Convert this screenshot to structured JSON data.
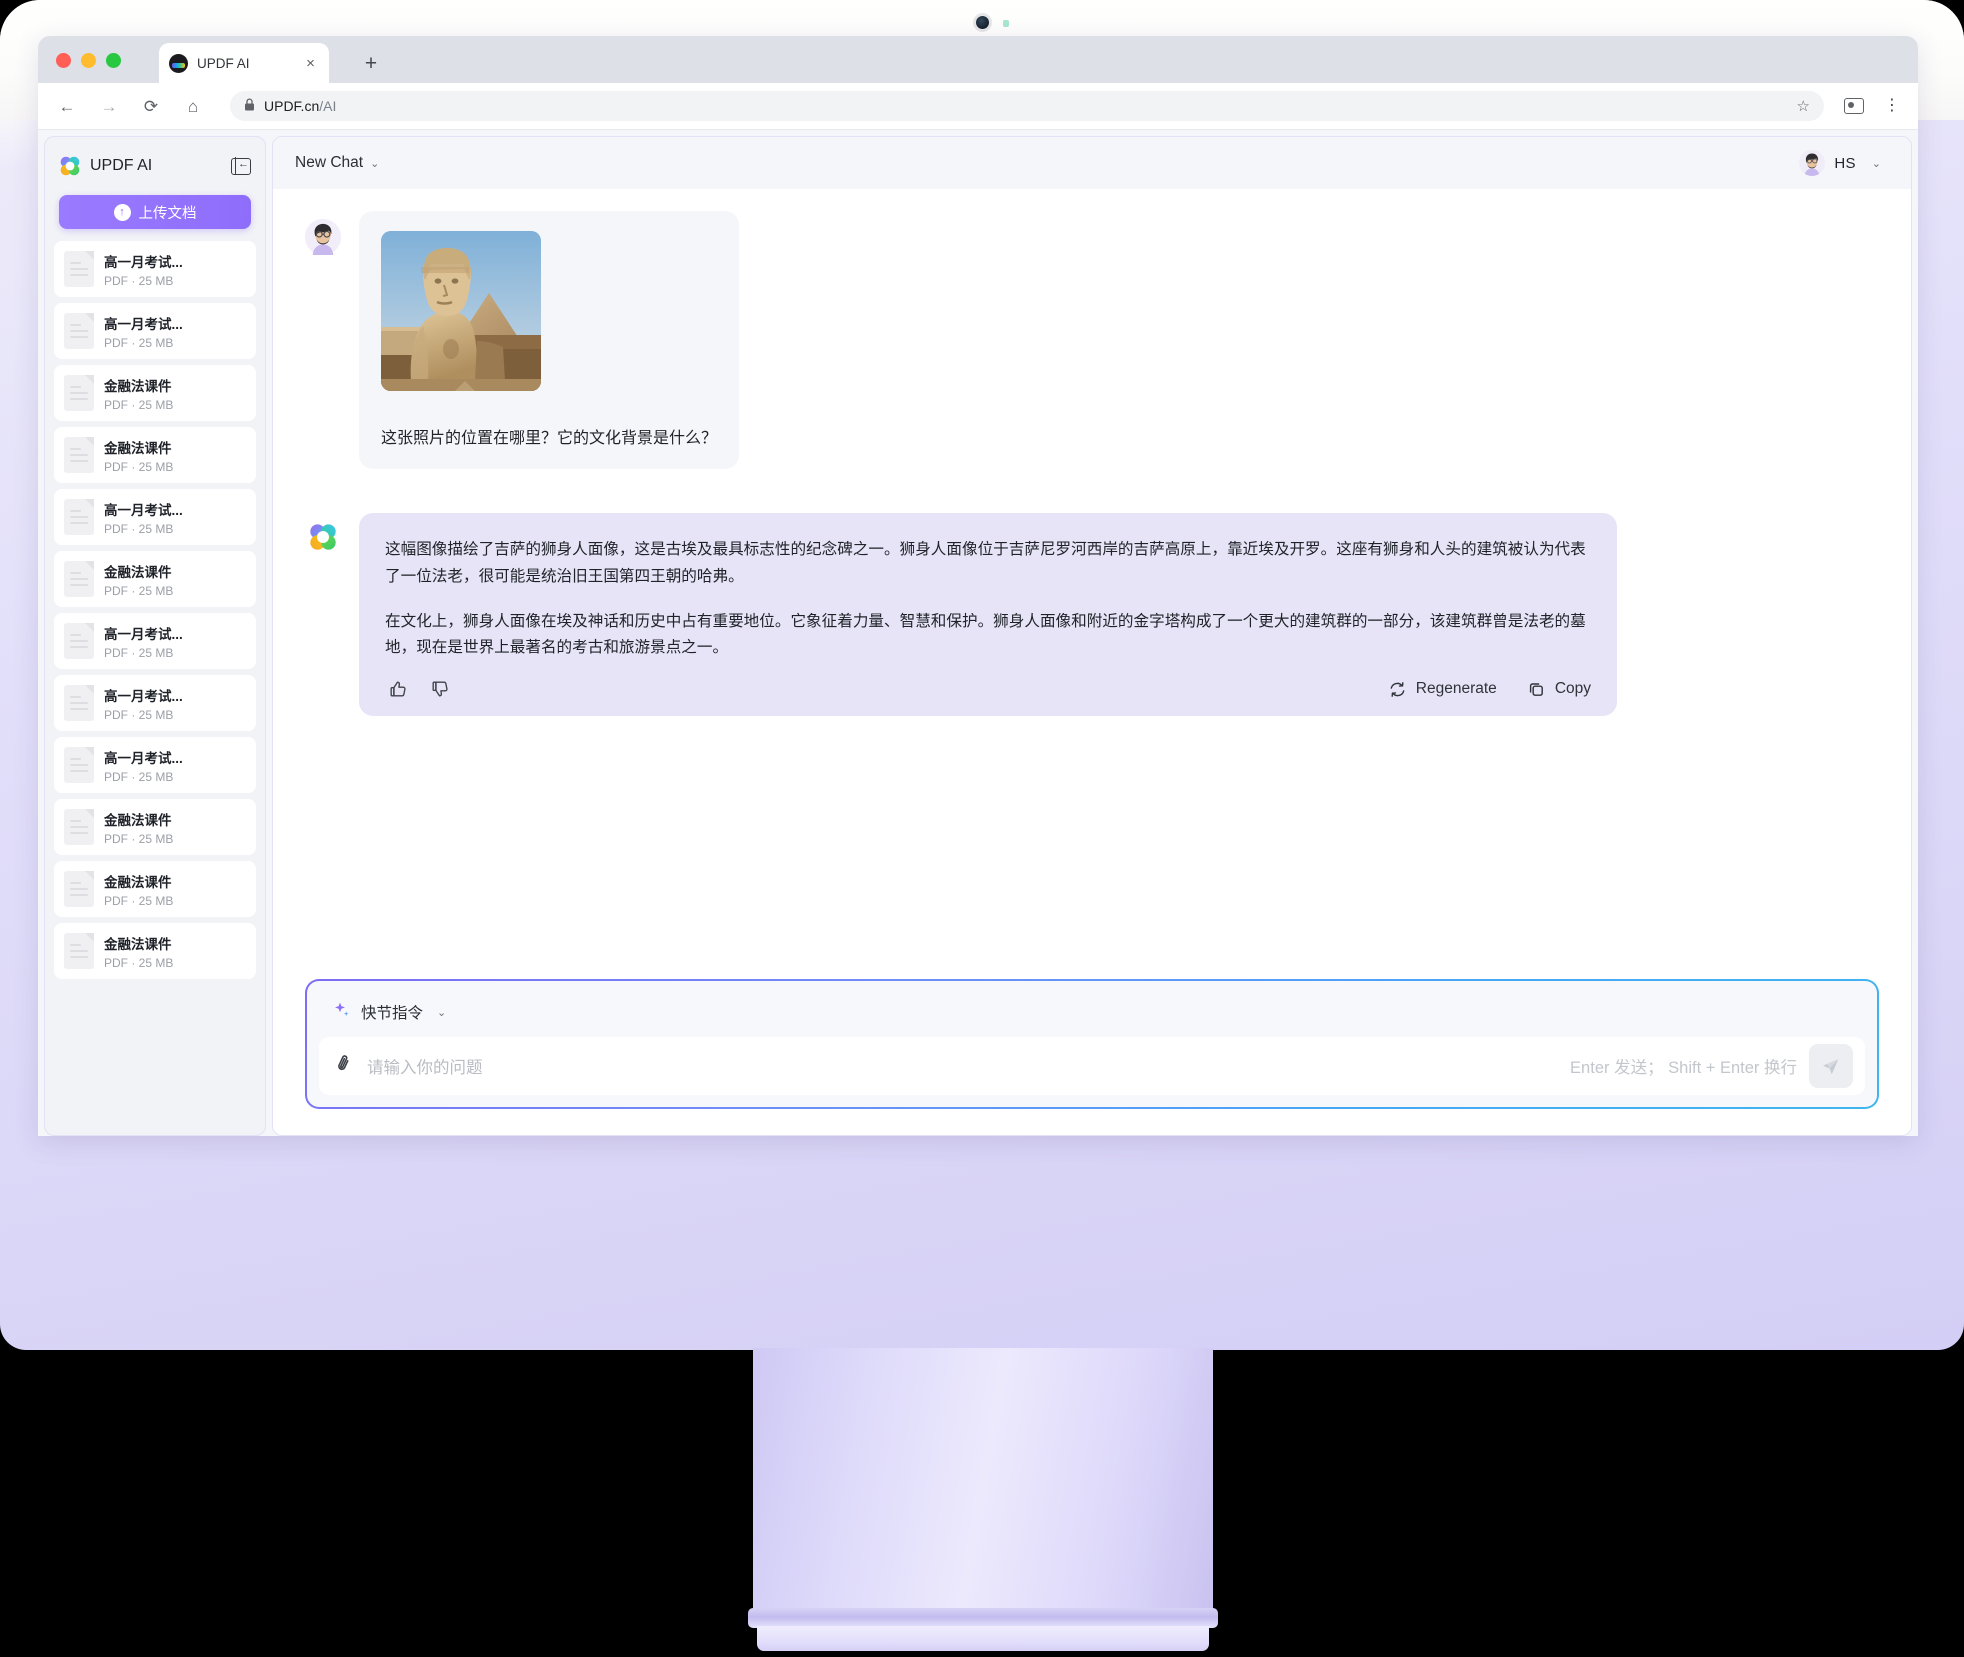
{
  "browser": {
    "tab_title": "UPDF AI",
    "tab_close_label": "×",
    "new_tab_label": "+",
    "back_label": "←",
    "forward_label": "→",
    "reload_label": "⟳",
    "home_label": "⌂",
    "lock_label": "🔒",
    "url_main": "UPDF.cn",
    "url_path": "/AI",
    "star_label": "☆",
    "menu_label": "⋮"
  },
  "sidebar": {
    "brand": "UPDF AI",
    "collapse_tooltip": "collapse-sidebar",
    "upload_button": "上传文档",
    "upload_icon": "↑",
    "documents": [
      {
        "name": "高一月考试...",
        "meta": "PDF · 25 MB"
      },
      {
        "name": "高一月考试...",
        "meta": "PDF · 25 MB"
      },
      {
        "name": "金融法课件",
        "meta": "PDF · 25 MB"
      },
      {
        "name": "金融法课件",
        "meta": "PDF · 25 MB"
      },
      {
        "name": "高一月考试...",
        "meta": "PDF · 25 MB"
      },
      {
        "name": "金融法课件",
        "meta": "PDF · 25 MB"
      },
      {
        "name": "高一月考试...",
        "meta": "PDF · 25 MB"
      },
      {
        "name": "高一月考试...",
        "meta": "PDF · 25 MB"
      },
      {
        "name": "高一月考试...",
        "meta": "PDF · 25 MB"
      },
      {
        "name": "金融法课件",
        "meta": "PDF · 25 MB"
      },
      {
        "name": "金融法课件",
        "meta": "PDF · 25 MB"
      },
      {
        "name": "金融法课件",
        "meta": "PDF · 25 MB"
      }
    ]
  },
  "chat": {
    "title": "New Chat",
    "title_chevron": "⌄",
    "user_initials": "HS",
    "user_chevron": "⌄",
    "user_message": {
      "image_alt": "sphinx-photo",
      "text": "这张照片的位置在哪里？它的文化背景是什么？"
    },
    "ai_message": {
      "paragraph1": "这幅图像描绘了吉萨的狮身人面像，这是古埃及最具标志性的纪念碑之一。狮身人面像位于吉萨尼罗河西岸的吉萨高原上，靠近埃及开罗。这座有狮身和人头的建筑被认为代表了一位法老，很可能是统治旧王国第四王朝的哈弗。",
      "paragraph2": "在文化上，狮身人面像在埃及神话和历史中占有重要地位。它象征着力量、智慧和保护。狮身人面像和附近的金字塔构成了一个更大的建筑群的一部分，该建筑群曾是法老的墓地，现在是世界上最著名的考古和旅游景点之一。",
      "thumbs_up": "👍",
      "thumbs_down": "👎",
      "regenerate_label": "Regenerate",
      "copy_label": "Copy"
    }
  },
  "composer": {
    "quick_label": "快节指令",
    "quick_chevron": "⌄",
    "spark_icon": "✦",
    "attach_icon": "📎",
    "placeholder": "请输入你的问题",
    "send_hint": "Enter 发送； Shift + Enter 换行"
  },
  "colors": {
    "accent_purple": "#8e6dfb",
    "ai_bubble": "#e6e4f6",
    "user_bubble": "#f5f6f9",
    "monitor_body": "#ddd9fa"
  }
}
